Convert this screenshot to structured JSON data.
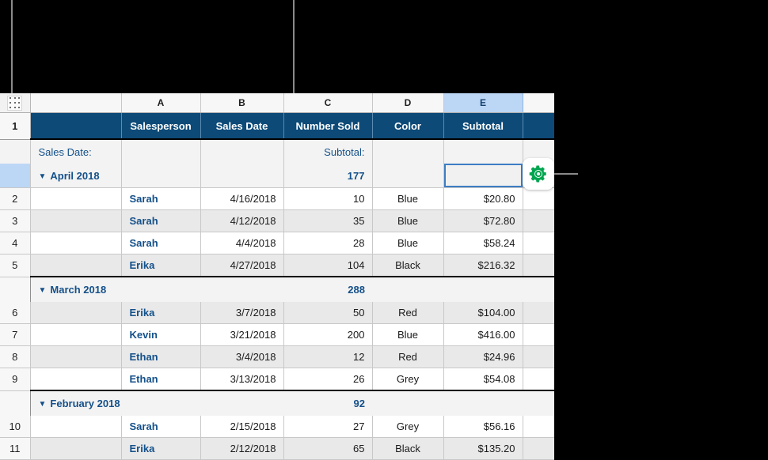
{
  "spreadsheet": {
    "corner_icon": "grid-dots-icon",
    "column_letters": [
      "A",
      "B",
      "C",
      "D",
      "E"
    ],
    "selected_column": "E",
    "title_row_number": "1",
    "title_row_label": "",
    "headers": {
      "label": "",
      "a": "Salesperson",
      "b": "Sales Date",
      "c": "Number Sold",
      "d": "Color",
      "e": "Subtotal"
    },
    "category_header": {
      "field_label": "Sales Date:",
      "summary_label": "Subtotal:",
      "group_name": "April 2018",
      "group_total": "177",
      "disclosure": "▼"
    },
    "groups": [
      {
        "name": "April 2018",
        "total": "177",
        "is_header_block": true,
        "rows": [
          {
            "num": "2",
            "name": "Sarah",
            "date": "4/16/2018",
            "sold": "10",
            "color": "Blue",
            "subtotal": "$20.80"
          },
          {
            "num": "3",
            "name": "Sarah",
            "date": "4/12/2018",
            "sold": "35",
            "color": "Blue",
            "subtotal": "$72.80"
          },
          {
            "num": "4",
            "name": "Sarah",
            "date": "4/4/2018",
            "sold": "28",
            "color": "Blue",
            "subtotal": "$58.24"
          },
          {
            "num": "5",
            "name": "Erika",
            "date": "4/27/2018",
            "sold": "104",
            "color": "Black",
            "subtotal": "$216.32"
          }
        ]
      },
      {
        "name": "March 2018",
        "total": "288",
        "is_header_block": false,
        "rows": [
          {
            "num": "6",
            "name": "Erika",
            "date": "3/7/2018",
            "sold": "50",
            "color": "Red",
            "subtotal": "$104.00"
          },
          {
            "num": "7",
            "name": "Kevin",
            "date": "3/21/2018",
            "sold": "200",
            "color": "Blue",
            "subtotal": "$416.00"
          },
          {
            "num": "8",
            "name": "Ethan",
            "date": "3/4/2018",
            "sold": "12",
            "color": "Red",
            "subtotal": "$24.96"
          },
          {
            "num": "9",
            "name": "Ethan",
            "date": "3/13/2018",
            "sold": "26",
            "color": "Grey",
            "subtotal": "$54.08"
          }
        ]
      },
      {
        "name": "February 2018",
        "total": "92",
        "is_header_block": false,
        "rows": [
          {
            "num": "10",
            "name": "Sarah",
            "date": "2/15/2018",
            "sold": "27",
            "color": "Grey",
            "subtotal": "$56.16"
          },
          {
            "num": "11",
            "name": "Erika",
            "date": "2/12/2018",
            "sold": "65",
            "color": "Black",
            "subtotal": "$135.20"
          }
        ]
      }
    ]
  },
  "gear_button": {
    "icon": "gear-icon",
    "color": "#00a550"
  },
  "colors": {
    "header_navy": "#0d4a78",
    "accent_blue": "#14508a",
    "selection_blue": "#3d7ec4",
    "column_select_fill": "#bcd6f5",
    "stripe_gray": "#e9e9e9",
    "gear_green": "#00a550",
    "leader_line": "#8a8a8a"
  }
}
